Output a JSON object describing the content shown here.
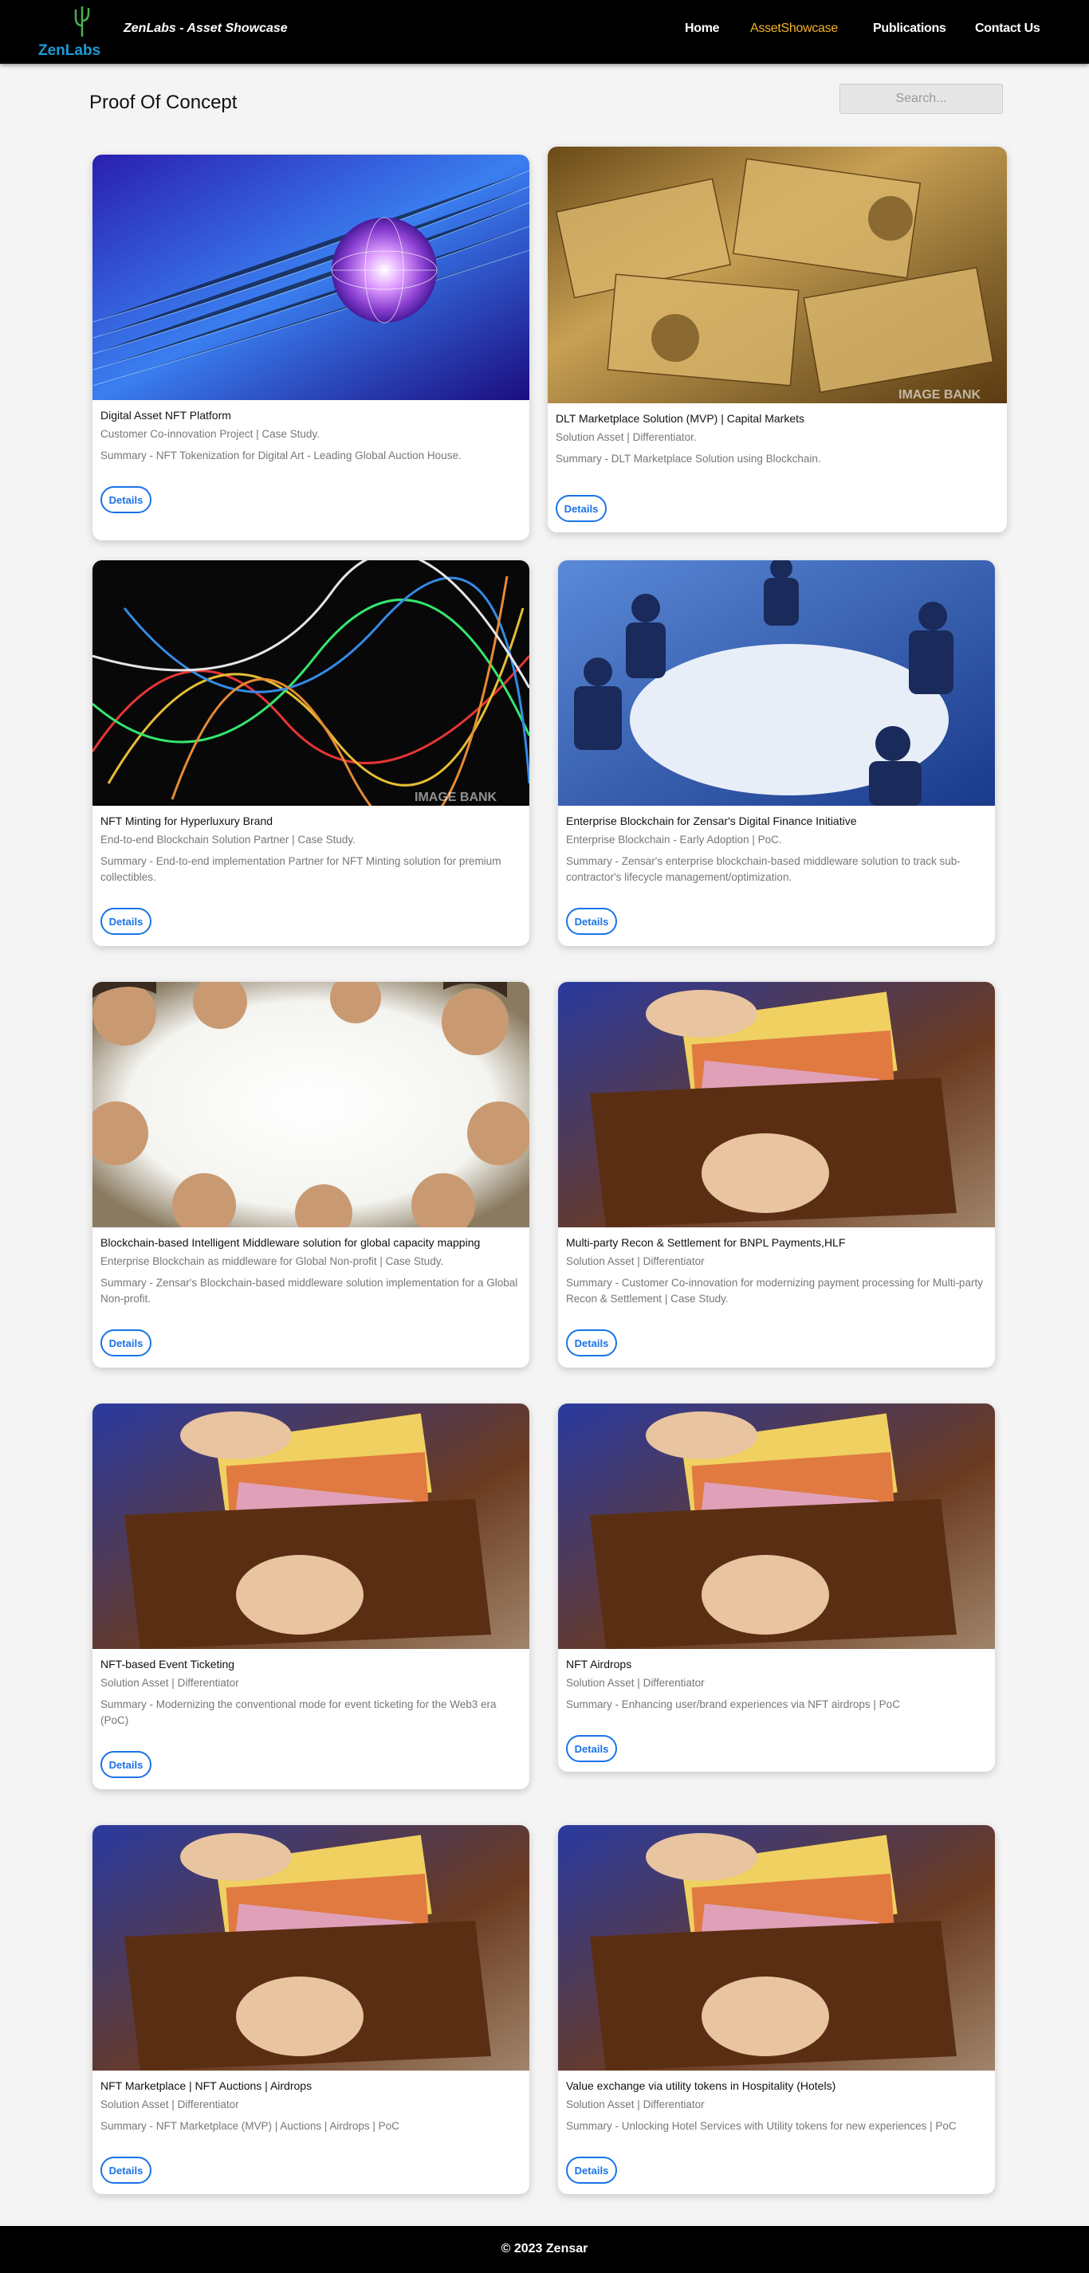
{
  "header": {
    "logo_text": "ZenLabs",
    "brand": "ZenLabs - Asset Showcase",
    "nav": [
      {
        "label": "Home",
        "active": false
      },
      {
        "label": "AssetShowcase",
        "active": true
      },
      {
        "label": "Publications",
        "active": false
      },
      {
        "label": "Contact Us",
        "active": false
      }
    ]
  },
  "page": {
    "title": "Proof Of Concept",
    "search_placeholder": "Search..."
  },
  "cards": [
    {
      "title": "Digital Asset NFT Platform",
      "subtitle": "Customer Co-innovation Project | Case Study.",
      "summary": "Summary - NFT Tokenization for Digital Art - Leading Global Auction House.",
      "button": "Details",
      "image": "globe-network"
    },
    {
      "title": "DLT Marketplace Solution (MVP) | Capital Markets",
      "subtitle": "Solution Asset | Differentiator.",
      "summary": "Summary - DLT Marketplace Solution using Blockchain.",
      "button": "Details",
      "image": "banknotes",
      "watermark": "IMAGE BANK"
    },
    {
      "title": "NFT Minting for Hyperluxury Brand",
      "subtitle": "End-to-end Blockchain Solution Partner | Case Study.",
      "summary": "Summary - End-to-end implementation Partner for NFT Minting solution for premium collectibles.",
      "button": "Details",
      "image": "light-trails",
      "watermark": "IMAGE BANK"
    },
    {
      "title": "Enterprise Blockchain for Zensar's Digital Finance Initiative",
      "subtitle": "Enterprise Blockchain - Early Adoption | PoC.",
      "summary": "Summary - Zensar's enterprise blockchain-based middleware solution to track sub-contractor's lifecycle management/optimization.",
      "button": "Details",
      "image": "meeting-table"
    },
    {
      "title": "Blockchain-based Intelligent Middleware solution for global capacity mapping",
      "subtitle": "Enterprise Blockchain as middleware for Global Non-profit | Case Study.",
      "summary": "Summary - Zensar's Blockchain-based middleware solution implementation for a Global Non-profit.",
      "button": "Details",
      "image": "people-circle"
    },
    {
      "title": "Multi-party Recon & Settlement for BNPL Payments,HLF",
      "subtitle": "Solution Asset | Differentiator",
      "summary": "Summary - Customer Co-innovation for modernizing payment processing for Multi-party Recon & Settlement | Case Study.",
      "button": "Details",
      "image": "wallet-euro"
    },
    {
      "title": "NFT-based Event Ticketing",
      "subtitle": "Solution Asset | Differentiator",
      "summary": "Summary - Modernizing the conventional mode for event ticketing for the Web3 era (PoC)",
      "button": "Details",
      "image": "wallet-euro"
    },
    {
      "title": "NFT Airdrops",
      "subtitle": "Solution Asset | Differentiator",
      "summary": "Summary - Enhancing user/brand experiences via NFT airdrops | PoC",
      "button": "Details",
      "image": "wallet-euro"
    },
    {
      "title": "NFT Marketplace | NFT Auctions | Airdrops",
      "subtitle": "Solution Asset | Differentiator",
      "summary": "Summary - NFT Marketplace (MVP) | Auctions | Airdrops | PoC",
      "button": "Details",
      "image": "wallet-euro"
    },
    {
      "title": "Value exchange via utility tokens in Hospitality (Hotels)",
      "subtitle": "Solution Asset | Differentiator",
      "summary": "Summary - Unlocking Hotel Services with Utility tokens for new experiences | PoC",
      "button": "Details",
      "image": "wallet-euro"
    }
  ],
  "footer": {
    "text": "© 2023 Zensar"
  },
  "colors": {
    "accent": "#1a73e8",
    "nav_active": "#f5b324",
    "header_bg": "#000000"
  }
}
